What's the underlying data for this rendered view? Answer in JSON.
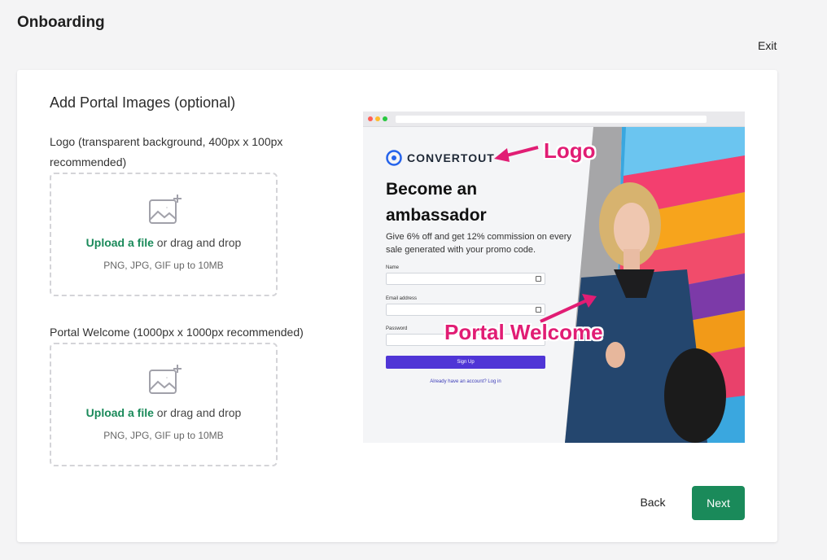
{
  "header": {
    "title": "Onboarding",
    "exit_label": "Exit"
  },
  "card": {
    "title": "Add Portal Images (optional)",
    "logo_field": {
      "label": "Logo (transparent background, 400px x 100px recommended)",
      "upload_link": "Upload a file",
      "upload_suffix": "or drag and drop",
      "hint": "PNG, JPG, GIF up to 10MB"
    },
    "welcome_field": {
      "label": "Portal Welcome (1000px x 1000px recommended)",
      "upload_link": "Upload a file",
      "upload_suffix": "or drag and drop",
      "hint": "PNG, JPG, GIF up to 10MB"
    }
  },
  "preview": {
    "brand_name": "CONVERTOUT",
    "headline": "Become an ambassador",
    "subtext": "Give 6% off and get 12% commission on every sale generated with your promo code.",
    "name_label": "Name",
    "email_label": "Email address",
    "password_label": "Password",
    "signup_label": "Sign Up",
    "login_text": "Already have an account? Log in",
    "annotation_logo": "Logo",
    "annotation_welcome": "Portal Welcome"
  },
  "footer": {
    "back_label": "Back",
    "next_label": "Next"
  },
  "colors": {
    "accent": "#1a8a5a",
    "annotation": "#e11d74",
    "signup": "#4f35d6"
  }
}
